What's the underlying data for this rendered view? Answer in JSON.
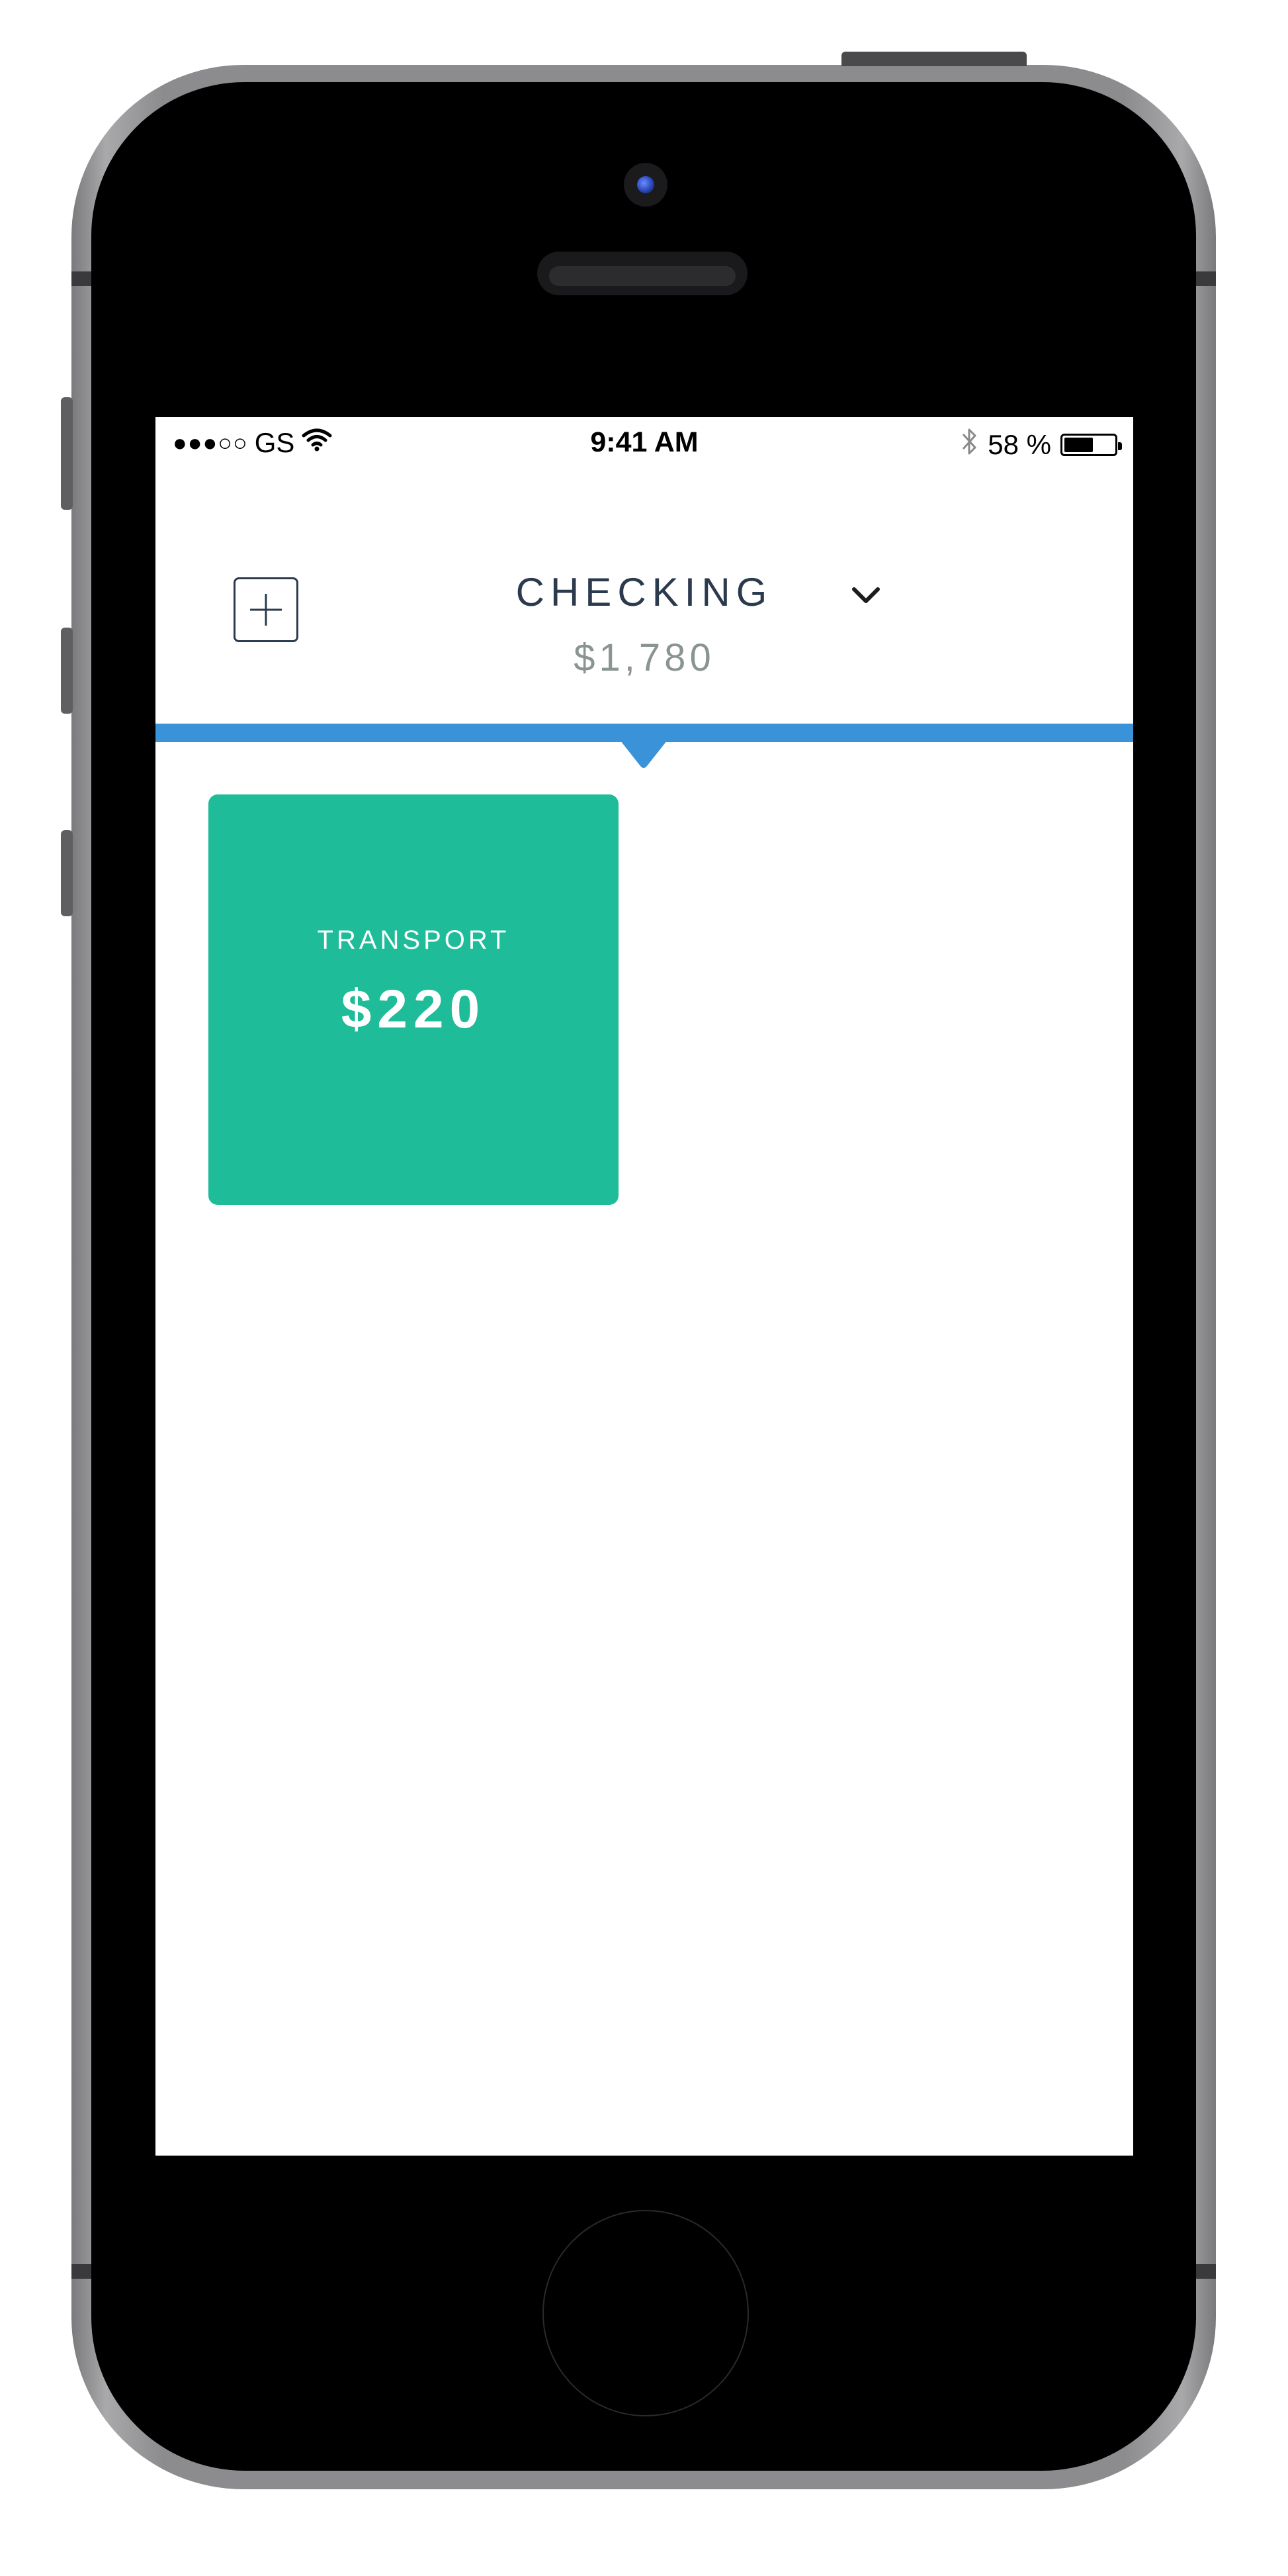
{
  "status_bar": {
    "signal": "●●●○○",
    "carrier": "GS",
    "time": "9:41 AM",
    "battery_text": "58 %",
    "battery_level": 0.58
  },
  "header": {
    "account_name": "CHECKING",
    "account_balance": "$1,780"
  },
  "categories": [
    {
      "label": "TRANSPORT",
      "amount": "$220"
    }
  ],
  "colors": {
    "accent_bar": "#3a93d8",
    "card_background": "#1ebc99",
    "title_text": "#2b3a4d",
    "balance_text": "#8a9493"
  },
  "icons": {
    "add": "plus-box-icon",
    "dropdown": "chevron-down-icon",
    "wifi": "wifi-icon",
    "bluetooth": "bluetooth-icon",
    "battery": "battery-icon"
  }
}
